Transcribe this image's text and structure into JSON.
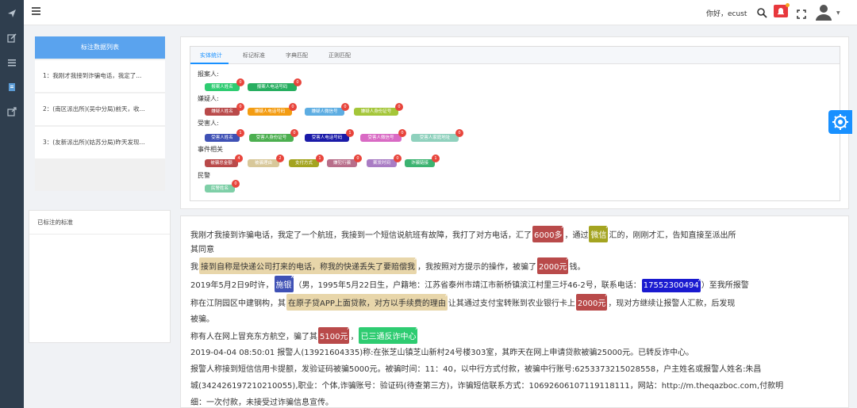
{
  "topbar": {
    "greeting": "你好，ecust"
  },
  "left_panel": {
    "header": "标注数据列表",
    "items": [
      {
        "label": "1：我刚才我接到诈骗电话，我定了..."
      },
      {
        "label": "2：(南区派出所)(吴中分局)前天，收..."
      },
      {
        "label": "3：(友新派出所)(姑苏分局)昨天发现..."
      }
    ]
  },
  "labeled_panel": {
    "title": "已标注的标准"
  },
  "stats": {
    "tabs": [
      {
        "label": "实体统计"
      },
      {
        "label": "标记标准"
      },
      {
        "label": "字典匹配"
      },
      {
        "label": "正则匹配"
      }
    ],
    "sections": [
      {
        "title": "报案人:",
        "tags": [
          {
            "label": "报案人姓名",
            "count": "0",
            "color": "#2ecc71"
          },
          {
            "label": "报案人电话号码",
            "count": "0",
            "color": "#27ae60"
          }
        ]
      },
      {
        "title": "嫌疑人:",
        "tags": [
          {
            "label": "嫌疑人姓名",
            "count": "0",
            "color": "#b94a4a"
          },
          {
            "label": "嫌疑人电话号码",
            "count": "0",
            "color": "#f39c12"
          },
          {
            "label": "嫌疑人微信号",
            "count": "0",
            "color": "#5dade2"
          },
          {
            "label": "嫌疑人身份证号",
            "count": "0",
            "color": "#a4c639"
          }
        ]
      },
      {
        "title": "受害人:",
        "tags": [
          {
            "label": "受害人姓名",
            "count": "1",
            "color": "#3f51b5"
          },
          {
            "label": "受害人身份证号",
            "count": "0",
            "color": "#4caf50"
          },
          {
            "label": "受害人电话号码",
            "count": "1",
            "color": "#1a1aa8"
          },
          {
            "label": "受害人微信号",
            "count": "0",
            "color": "#d96ac4"
          },
          {
            "label": "受害人家庭地址",
            "count": "0",
            "color": "#8fd1bd"
          }
        ]
      },
      {
        "title": "事件相关",
        "tags": [
          {
            "label": "被骗总金额",
            "count": "4",
            "color": "#b94a4a"
          },
          {
            "label": "被骗理由",
            "count": "2",
            "color": "#d8c89a"
          },
          {
            "label": "支付方式",
            "count": "1",
            "color": "#a4a420"
          },
          {
            "label": "嫌犯行骗",
            "count": "0",
            "color": "#b86e8a"
          },
          {
            "label": "案发时间",
            "count": "0",
            "color": "#a97cc4"
          },
          {
            "label": "诈骗链接",
            "count": "1",
            "color": "#3cb371"
          }
        ]
      },
      {
        "title": "民警",
        "tags": [
          {
            "label": "民警姓名",
            "count": "0",
            "color": "#7ecfa7"
          }
        ]
      }
    ]
  },
  "text_panel": {
    "line1a": "我刚才我接到诈骗电话，我定了一个航班，我接到一个短信说航班有故障，我打了对方电话，汇了",
    "hl_6000": "6000多",
    "line1b": "，通过",
    "hl_wechat": "微信",
    "line1c": "汇的，刚刚才汇，告知直接至派出所",
    "line2": "其同意",
    "line3a": "我",
    "hl_reason1": "接到自称是快递公司打来的电话，称我的快递丢失了要赔偿我",
    "line3b": "，我按照对方提示的操作，被骗了",
    "hl_2000a": "2000元",
    "line3c": "钱。",
    "line4a": "2019年5月2日9时许，",
    "hl_name": "施银",
    "line4b": "（男，1995年5月22日生，户籍地：江苏省泰州市靖江市新桥镇滨江村里三圩46-2号，联系电话：",
    "hl_phone": "17552300494",
    "line4c": "）至我所报警",
    "line5a": "称在江阴园区中建钢构，其",
    "hl_reason2": "在原子贷APP上面贷款，对方以手续费的理由",
    "line5b": "让其通过支付宝转账到农业银行卡上",
    "hl_2000b": "2000元",
    "line5c": "，现对方继续让报警人汇款，后发现",
    "line6": "被骗。",
    "line7a": "称有人在网上冒充东方航空，骗了其",
    "hl_5100": "5100元",
    "line7b": "，",
    "hl_report": "已三通反诈中心",
    "line8": "2019-04-04 08:50:01 报警人(13921604335)称:在张芝山镇芝山新村24号楼303室，其昨天在网上申请贷款被骗25000元。已转反诈中心。",
    "line9": "报警人称接到短信信用卡提额，发验证码被骗5000元。被骗时间：11：40，以中行方式付款，被骗中行账号:6253373215028558，户主姓名或报警人姓名:朱昌",
    "line10": "城(342426197210210055),职业：个体,诈骗账号：验证码(待查第三方)，诈骗短信联系方式：10692606107119118111，网站：http://m.theqazboc.com,付款明",
    "line11": "细：一次付款，未接受过诈骗信息宣传。",
    "close_mark": "x"
  },
  "colors": {
    "accent": "#1890ff",
    "sidebar": "#2f3e4e"
  }
}
